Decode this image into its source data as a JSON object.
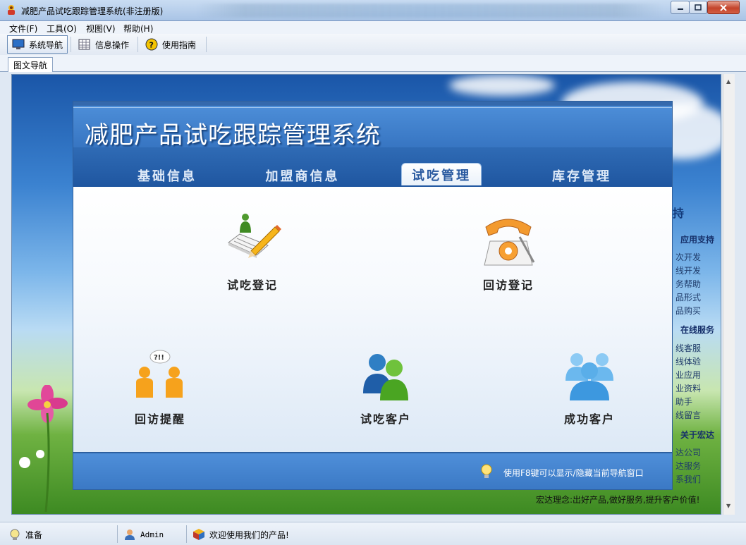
{
  "window": {
    "title": "减肥产品试吃跟踪管理系统(非注册版)",
    "min_label": "–",
    "max_label": "□",
    "close_label": "✕"
  },
  "menu": {
    "items": [
      "文件(F)",
      "工具(O)",
      "视图(V)",
      "帮助(H)"
    ]
  },
  "toolbar": {
    "items": [
      {
        "label": "系统导航",
        "icon": "monitor-icon",
        "active": true
      },
      {
        "label": "信息操作",
        "icon": "grid-icon",
        "active": false
      },
      {
        "label": "使用指南",
        "icon": "help-icon",
        "active": false
      }
    ]
  },
  "tabs": {
    "doc_tab": "图文导航"
  },
  "side_panel": {
    "partial_heading": "持",
    "sections": [
      {
        "heading": "应用支持",
        "items": [
          "次开发",
          "线开发",
          "务帮助",
          "品形式",
          "品购买"
        ]
      },
      {
        "heading": "在线服务",
        "items": [
          "线客服",
          "线体验",
          "业应用",
          "业资料",
          "助手",
          "线留言"
        ]
      },
      {
        "heading": "关于宏达",
        "items": [
          "达公司",
          "达服务",
          "系我们"
        ]
      }
    ],
    "motto": "宏达理念:出好产品,做好服务,提升客户价值!"
  },
  "nav": {
    "system_title": "减肥产品试吃跟踪管理系统",
    "tabs": [
      {
        "label": "基础信息",
        "active": false
      },
      {
        "label": "加盟商信息",
        "active": false
      },
      {
        "label": "试吃管理",
        "active": true
      },
      {
        "label": "库存管理",
        "active": false
      }
    ],
    "functions": [
      {
        "label": "试吃登记",
        "icon": "register-pencil-icon"
      },
      {
        "label": "回访登记",
        "icon": "telephone-icon"
      },
      {
        "label": "回访提醒",
        "icon": "reminder-people-icon"
      },
      {
        "label": "试吃客户",
        "icon": "customers-icon"
      },
      {
        "label": "成功客户",
        "icon": "success-group-icon"
      }
    ],
    "footer_hint": "使用F8键可以显示/隐藏当前导航窗口"
  },
  "status": {
    "state": "准备",
    "user": "Admin",
    "welcome": "欢迎使用我们的产品!"
  },
  "colors": {
    "header_blue": "#3775c2",
    "tab_blue": "#1f56a0",
    "active_tab_text": "#2a5aa0"
  }
}
